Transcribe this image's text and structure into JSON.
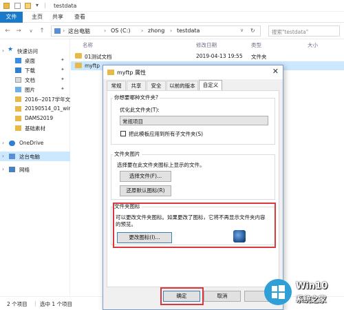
{
  "window": {
    "title": "testdata",
    "ribbon_tabs": [
      "文件",
      "主页",
      "共享",
      "查看"
    ]
  },
  "address": {
    "segments": [
      "这台电脑",
      "OS (C:)",
      "zhong",
      "testdata"
    ],
    "search_placeholder": "搜索\"testdata\""
  },
  "sidebar": {
    "quick_access": "快速访问",
    "pinned": [
      "桌面",
      "下载",
      "文档",
      "图片"
    ],
    "folders": [
      "2016--2017学年文",
      "20190514_01_wir",
      "DAMS2019",
      "基础素材"
    ],
    "onedrive": "OneDrive",
    "this_pc": "这台电脑",
    "network": "网络"
  },
  "filelist": {
    "columns": [
      "名称",
      "修改日期",
      "类型",
      "大小"
    ],
    "rows": [
      {
        "name": "01测试文档",
        "date": "2019-04-13 19:55",
        "type": "文件夹"
      },
      {
        "name": "myftp",
        "date": "",
        "type": ""
      }
    ]
  },
  "status": {
    "count": "2 个项目",
    "selected": "选中 1 个项目"
  },
  "dialog": {
    "title": "myftp 属性",
    "close": "✕",
    "tabs": [
      "常规",
      "共享",
      "安全",
      "以前的版本",
      "自定义"
    ],
    "active_tab": "自定义",
    "type_group_title": "你想要哪种文件夹?",
    "optimize_label": "优化此文件夹(T):",
    "optimize_value": "常规项目",
    "apply_sub_label": "把此模板应用到所有子文件夹(S)",
    "apply_sub_checked": false,
    "picture_group_title": "文件夹图片",
    "picture_desc": "选择要在此文件夹图标上显示的文件。",
    "choose_file_button": "选择文件(F)...",
    "restore_default_button": "还原默认图标(R)",
    "icon_group_title": "文件夹图标",
    "icon_desc_line1": "可以更改文件夹图标。如果更改了图标，它将不再显示文件夹内容",
    "icon_desc_line2": "的预览。",
    "change_icon_button": "更改图标(I)...",
    "ok_button": "确定",
    "cancel_button": "取消"
  },
  "watermark": {
    "brand": "Win10",
    "subtitle": "系统之家"
  },
  "colors": {
    "accent": "#1979ca",
    "selection": "#cce8ff",
    "highlight_box": "#d9363e",
    "folder": "#e8b84a"
  }
}
